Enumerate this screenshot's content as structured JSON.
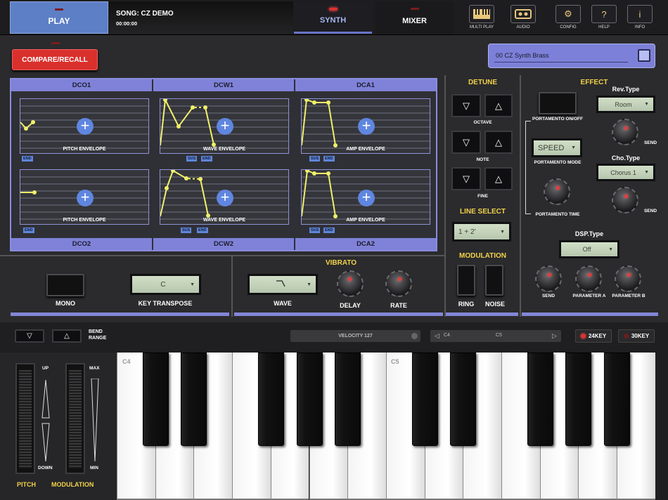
{
  "header": {
    "play_label": "PLAY",
    "song_title": "SONG: CZ DEMO",
    "song_time": "00:00:00",
    "tabs": [
      "SYNTH",
      "MIXER"
    ],
    "tools": [
      {
        "label": "MULTI PLAY",
        "icon": "keyboard-icon"
      },
      {
        "label": "AUDIO",
        "icon": "cassette-icon"
      },
      {
        "label": "CONFIG",
        "icon": "gear-icon"
      },
      {
        "label": "HELP",
        "icon": "help-icon"
      },
      {
        "label": "INFO",
        "icon": "info-icon"
      }
    ]
  },
  "compare_label": "COMPARE/RECALL",
  "patch_name": "00 CZ Synth Brass",
  "envelopes": {
    "top_headers": [
      "DCO1",
      "DCW1",
      "DCA1"
    ],
    "bottom_headers": [
      "DCO2",
      "DCW2",
      "DCA2"
    ],
    "labels": [
      "PITCH ENVELOPE",
      "WAVE ENVELOPE",
      "AMP ENVELOPE",
      "PITCH ENVELOPE",
      "WAVE ENVELOPE",
      "AMP ENVELOPE"
    ],
    "sus": "SUS",
    "end": "END"
  },
  "detune": {
    "title": "DETUNE",
    "octave": "OCTAVE",
    "note": "NOTE",
    "fine": "FINE"
  },
  "line_select": {
    "title": "LINE SELECT",
    "value": "1 + 2'"
  },
  "modulation": {
    "title": "MODULATION",
    "ring": "RING",
    "noise": "NOISE"
  },
  "effect": {
    "title": "EFFECT",
    "portamento_onoff": "PORTAMENTO ON/OFF",
    "portamento_mode": "PORTAMENTO MODE",
    "portamento_mode_value": "SPEED",
    "portamento_time": "PORTAMENTO TIME",
    "rev_type_label": "Rev.Type",
    "rev_type_value": "Room",
    "cho_type_label": "Cho.Type",
    "cho_type_value": "Chorus 1",
    "send": "SEND",
    "dsp_type_label": "DSP.Type",
    "dsp_type_value": "Off",
    "param_a": "PARAMETER A",
    "param_b": "PARAMETER B"
  },
  "lower": {
    "mono": "MONO",
    "key_transpose": "KEY TRANSPOSE",
    "key_transpose_value": "C",
    "vibrato_title": "VIBRATO",
    "wave": "WAVE",
    "delay": "DELAY",
    "rate": "RATE"
  },
  "keyboard_bar": {
    "bend_range": "BEND RANGE",
    "velocity": "VELOCITY 127",
    "range_low": "C4",
    "range_high": "C5",
    "key24": "24KEY",
    "key30": "30KEY"
  },
  "wheels": {
    "up": "UP",
    "down": "DOWN",
    "max": "MAX",
    "min": "MIN",
    "pitch": "PITCH",
    "modulation": "MODULATION"
  },
  "keys": {
    "c4": "C4",
    "c5": "C5"
  }
}
